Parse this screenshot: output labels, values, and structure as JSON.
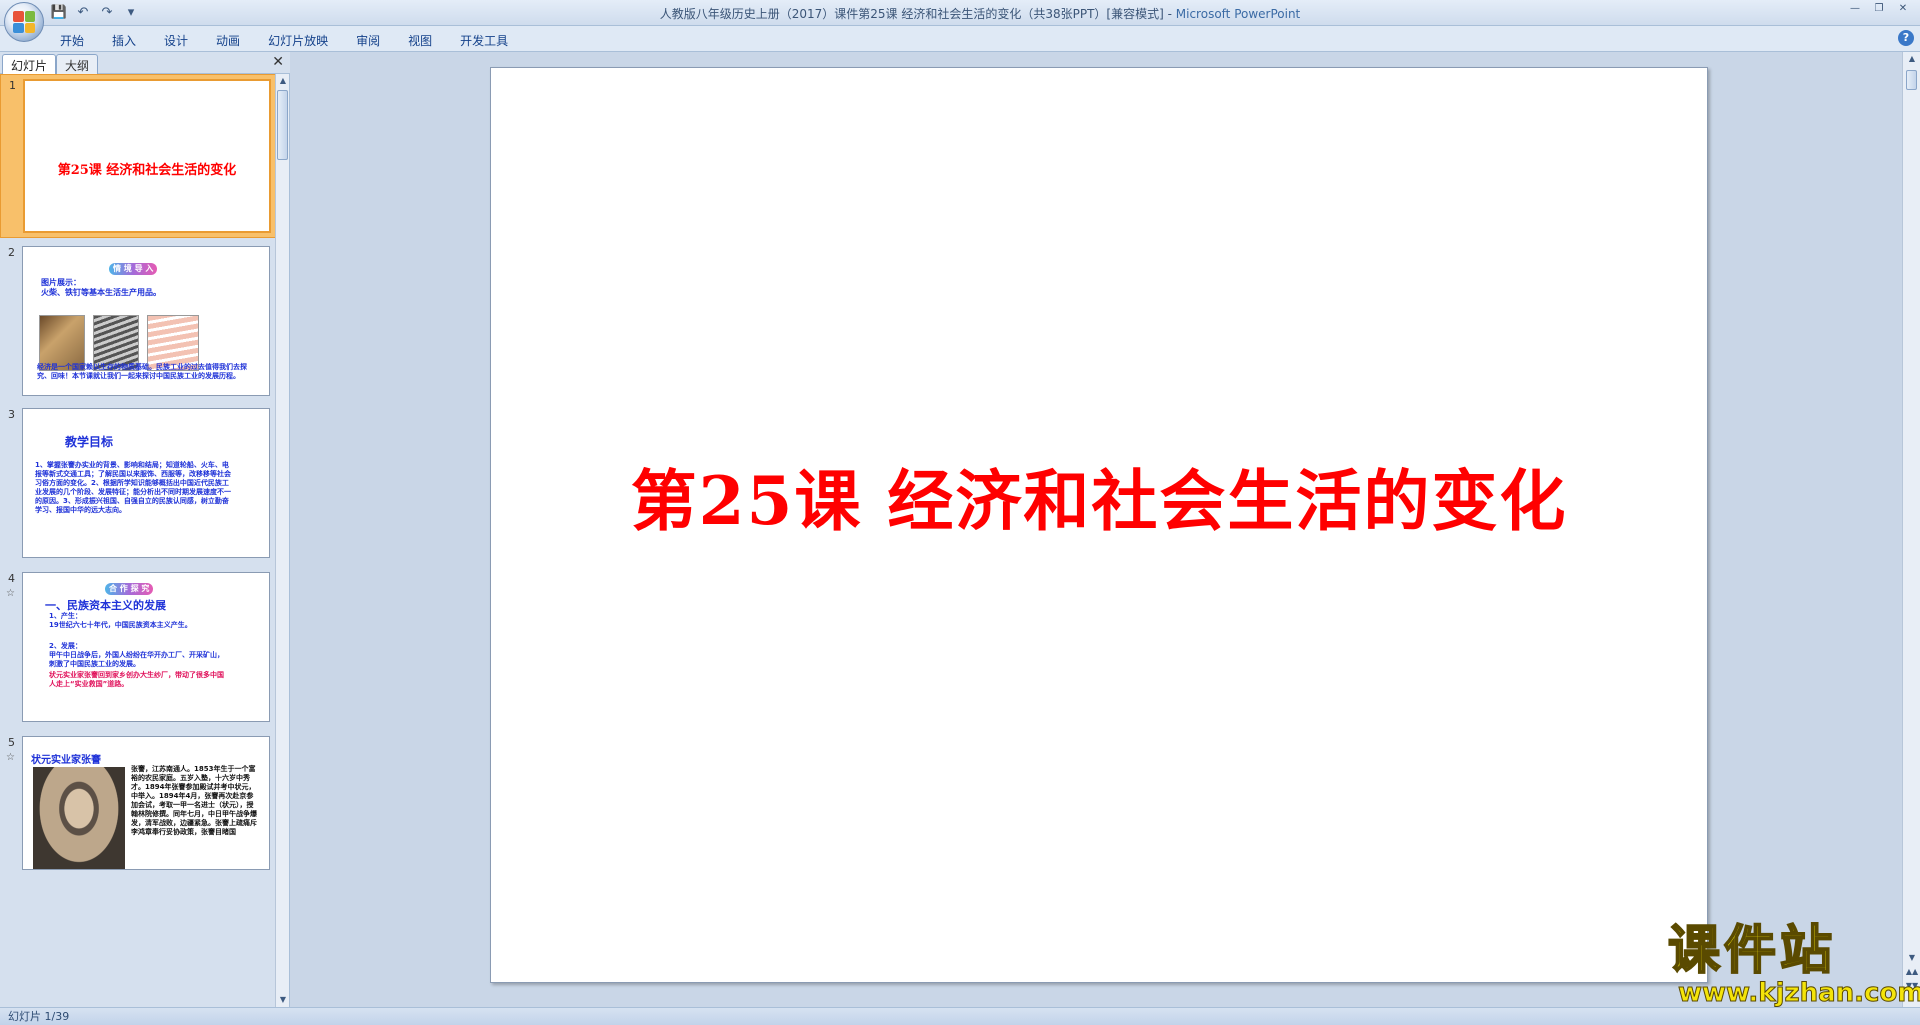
{
  "window": {
    "title_prefix": "人教版八年级历史上册（2017）课件第25课 经济和社会生活的变化（共38张PPT）[兼容模式]",
    "title_sep": " - ",
    "app_name": "Microsoft PowerPoint"
  },
  "ribbon": {
    "tabs": [
      "开始",
      "插入",
      "设计",
      "动画",
      "幻灯片放映",
      "审阅",
      "视图",
      "开发工具"
    ]
  },
  "panel": {
    "tab_slides": "幻灯片",
    "tab_outline": "大纲"
  },
  "thumbs": [
    {
      "num": "1",
      "title": "第25课 经济和社会生活的变化"
    },
    {
      "num": "2",
      "tag": "情 境 导 入",
      "heading": "图片展示：",
      "subheading": "火柴、铁钉等基本生活生产用品。",
      "body": "经济是一个国家赖以生存的物质基础。民族工业的过去值得我们去探究、回味！本节课就让我们一起来探讨中国民族工业的发展历程。"
    },
    {
      "num": "3",
      "heading": "教学目标",
      "body": "1、掌握张謇办实业的背景、影响和结局；知道轮船、火车、电报等新式交通工具；了解民国以来服饰、西服等，改移移等社会习俗方面的变化。2、根据所学知识能够概括出中国近代民族工业发展的几个阶段、发展特征；能分析出不同时期发展速度不一的原因。3、形成振兴祖国、自强自立的民族认同感，树立勤奋学习、报国中华的远大志向。"
    },
    {
      "num": "4",
      "tag": "合 作 探 究",
      "heading": "一、民族资本主义的发展",
      "line1": "1、产生：",
      "line2": "19世纪六七十年代，中国民族资本主义产生。",
      "line3": "2、发展：",
      "body": "甲午中日战争后，外国人纷纷在华开办工厂、开采矿山，刺激了中国民族工业的发展。",
      "body_red": "状元实业家张謇回到家乡创办大生纱厂，带动了很多中国人走上“实业救国”道路。"
    },
    {
      "num": "5",
      "heading": "状元实业家张謇",
      "body": "张謇，江苏南通人。1853年生于一个富裕的农民家庭。五岁入塾，十六岁中秀才。1894年张謇参加殿试并考中状元，中举入。1894年4月，张謇再次赴京参加会试，考取一甲一名进士（状元），授翰林院修撰。同年七月，中日甲午战争爆发，清军战败，边疆紧急。张謇上疏痛斥李鸿章奉行妥协政策，张謇目睹国"
    }
  ],
  "slide": {
    "title": "第25课 经济和社会生活的变化"
  },
  "status": {
    "slide_counter": "幻灯片 1/39"
  },
  "watermark": {
    "cn": "课件站",
    "url": "www.kjzhan.com"
  }
}
